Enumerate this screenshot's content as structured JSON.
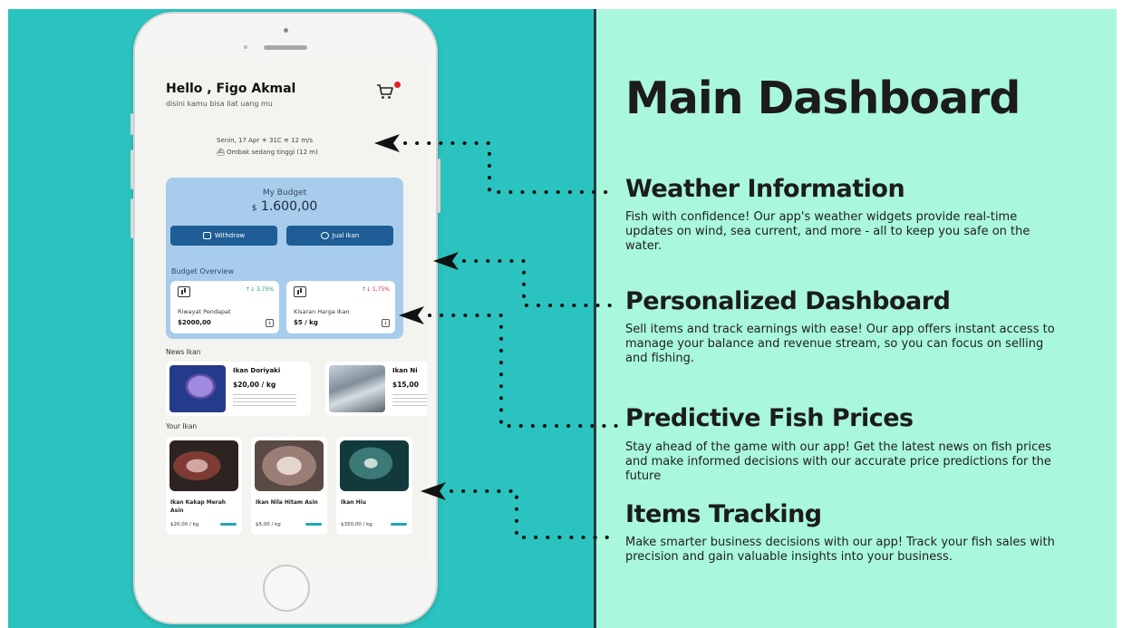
{
  "main": {
    "title": "Main Dashboard",
    "features": [
      {
        "title": "Weather Information",
        "description": "Fish with confidence! Our app's weather widgets provide real-time updates on wind, sea current, and more - all to keep you safe on the water."
      },
      {
        "title": "Personalized Dashboard",
        "description": "Sell items and track earnings with ease! Our app offers instant access to manage your balance and revenue stream, so you can focus on selling and fishing."
      },
      {
        "title": "Predictive Fish Prices",
        "description": "Stay ahead of the game with our app! Get the latest news on fish prices and make informed decisions with our accurate price predictions for the future"
      },
      {
        "title": "Items Tracking",
        "description": "Make smarter business decisions with our app! Track your fish sales with precision and gain valuable insights into your business."
      }
    ]
  },
  "app": {
    "greeting": "Hello , Figo Akmal",
    "subtitle": "disini kamu bisa liat uang mu",
    "weather": {
      "line1": "Senin, 17 Apr  ☀ 31C  ≋ 12 m/s",
      "line2": "⛴ Ombak sedang tinggi (12 m)"
    },
    "budget": {
      "label": "My Budget",
      "currency": "$",
      "amount": "1.600,00",
      "withdraw_label": "Withdraw",
      "jual_label": "Jual Ikan",
      "overview_title": "Budget Overview",
      "cards": [
        {
          "pct": "↑↓ 3,75%",
          "label": "Riwayat Pendapat",
          "value": "$2000,00"
        },
        {
          "pct": "↑↓ 1,75%",
          "label": "Kisaran Harga Ikan",
          "value": "$5 / kg"
        }
      ]
    },
    "news": {
      "title": "News Ikan",
      "items": [
        {
          "name": "Ikan Doriyaki",
          "price": "$20,00 / kg"
        },
        {
          "name": "Ikan Ni",
          "price": "$15,00"
        }
      ]
    },
    "your_ikan": {
      "title": "Your Ikan",
      "items": [
        {
          "name": "Ikan Kakap Merah Asin",
          "price": "$20,00 / kg"
        },
        {
          "name": "Ikan Nila Hitam Asin",
          "price": "$5,00 / kg"
        },
        {
          "name": "Ikan Hiu",
          "price": "$350,00 / kg"
        }
      ]
    }
  },
  "colors": {
    "left_bg": "#2bc3bf",
    "right_bg": "#a9f7dc",
    "budget_card": "#a7ccec",
    "button": "#1e5d95",
    "up": "#19a85a",
    "down": "#d9313a"
  }
}
